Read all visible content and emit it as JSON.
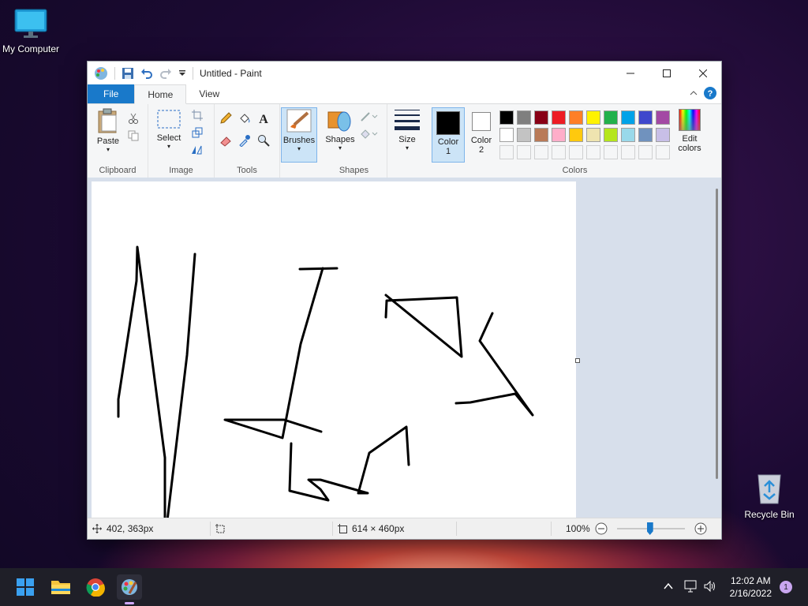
{
  "desktop": {
    "my_computer": "My Computer",
    "recycle_bin": "Recycle Bin"
  },
  "window": {
    "title": "Untitled - Paint"
  },
  "tabs": {
    "file": "File",
    "home": "Home",
    "view": "View"
  },
  "ribbon": {
    "clipboard": {
      "paste": "Paste",
      "group": "Clipboard"
    },
    "image": {
      "select": "Select",
      "group": "Image"
    },
    "tools": {
      "group": "Tools"
    },
    "brushes": {
      "label": "Brushes"
    },
    "shapes": {
      "label": "Shapes",
      "group": "Shapes"
    },
    "size": {
      "label": "Size"
    },
    "colors": {
      "color1": "Color",
      "color1_num": "1",
      "color2": "Color",
      "color2_num": "2",
      "edit": "Edit",
      "edit2": "colors",
      "group": "Colors",
      "color1_value": "#000000",
      "color2_value": "#ffffff",
      "palette": [
        "#000000",
        "#7f7f7f",
        "#880015",
        "#ed1c24",
        "#ff7f27",
        "#fff200",
        "#22b14c",
        "#00a2e8",
        "#3f48cc",
        "#a349a4",
        "#ffffff",
        "#c3c3c3",
        "#b97a57",
        "#ffaec9",
        "#ffc90e",
        "#efe4b0",
        "#b5e61d",
        "#99d9ea",
        "#7092be",
        "#c8bfe7"
      ]
    }
  },
  "status": {
    "cursor_pos": "402, 363px",
    "canvas_size": "614 × 460px",
    "zoom": "100%"
  },
  "taskbar": {
    "time": "12:02 AM",
    "date": "2/16/2022",
    "notifications": "1"
  }
}
